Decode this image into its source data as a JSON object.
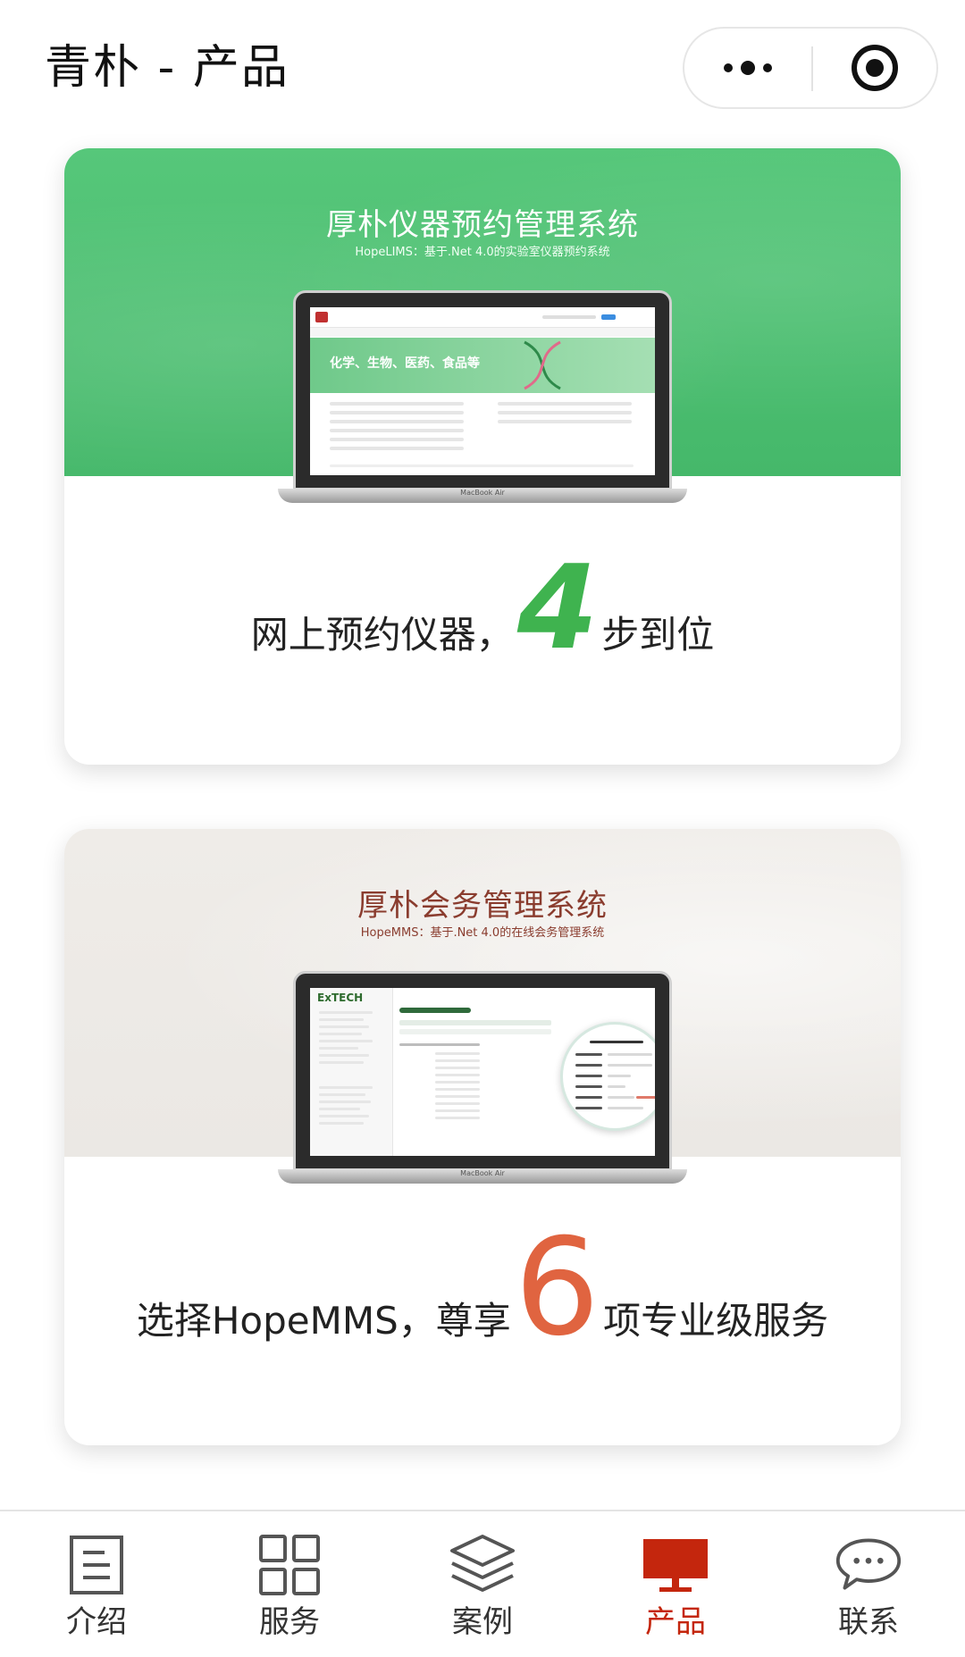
{
  "header": {
    "title": "青朴 - 产品",
    "menu_icon": "more-dots-icon",
    "target_icon": "target-circle-icon"
  },
  "products": [
    {
      "banner_title": "厚朴仪器预约管理系统",
      "banner_subtitle": "HopeLIMS：基于.Net 4.0的实验室仪器预约系统",
      "screen_hero_text": "化学、生物、医药、食品等",
      "slogan_before": "网上预约仪器，",
      "slogan_number": "4",
      "slogan_after": "步到位",
      "laptop_label": "MacBook Air",
      "accent_color": "#3fb34f"
    },
    {
      "banner_title": "厚朴会务管理系统",
      "banner_subtitle": "HopeMMS：基于.Net 4.0的在线会务管理系统",
      "screen_brand": "ExTECH",
      "slogan_before": "选择HopeMMS，尊享",
      "slogan_number": "6",
      "slogan_after": "项专业级服务",
      "laptop_label": "MacBook Air",
      "accent_color": "#e06440"
    }
  ],
  "tabbar": {
    "active_color": "#c4260d",
    "items": [
      {
        "label": "介绍",
        "icon": "document-icon"
      },
      {
        "label": "服务",
        "icon": "grid-icon"
      },
      {
        "label": "案例",
        "icon": "layers-icon"
      },
      {
        "label": "产品",
        "icon": "monitor-icon"
      },
      {
        "label": "联系",
        "icon": "chat-bubble-icon"
      }
    ],
    "active_index": 3
  }
}
